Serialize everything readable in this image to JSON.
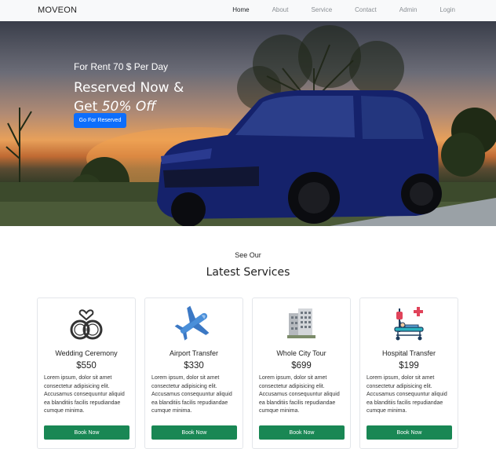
{
  "navbar": {
    "brand": "MOVEON",
    "links": [
      "Home",
      "About",
      "Service",
      "Contact",
      "Admin",
      "Login"
    ]
  },
  "hero": {
    "subtitle": "For Rent 70 $ Per Day",
    "title_line1": "Reserved Now &",
    "title_line2_prefix": "Get ",
    "title_line2_emph": "50% Off",
    "button": "Go For Reserved"
  },
  "section": {
    "kicker": "See Our",
    "title": "Latest Services"
  },
  "services": [
    {
      "name": "Wedding Ceremony",
      "price": "$550",
      "icon": "wedding-rings-icon",
      "desc": "Lorem ipsum, dolor sit amet consectetur adipisicing elit. Accusamus consequuntur aliquid ea blanditiis facilis repudiandae cumque minima.",
      "button": "Book Now"
    },
    {
      "name": "Airport Transfer",
      "price": "$330",
      "icon": "airplane-icon",
      "desc": "Lorem ipsum, dolor sit amet consectetur adipisicing elit. Accusamus consequuntur aliquid ea blanditiis facilis repudiandae cumque minima.",
      "button": "Book Now"
    },
    {
      "name": "Whole City Tour",
      "price": "$699",
      "icon": "city-building-icon",
      "desc": "Lorem ipsum, dolor sit amet consectetur adipisicing elit. Accusamus consequuntur aliquid ea blanditiis facilis repudiandae cumque minima.",
      "button": "Book Now"
    },
    {
      "name": "Hospital Transfer",
      "price": "$199",
      "icon": "hospital-bed-icon",
      "desc": "Lorem ipsum, dolor sit amet consectetur adipisicing elit. Accusamus consequuntur aliquid ea blanditiis facilis repudiandae cumque minima.",
      "button": "Book Now"
    }
  ],
  "colors": {
    "primary_button": "#0d6efd",
    "book_button": "#198754",
    "navbar_bg": "#f8f9fa"
  }
}
